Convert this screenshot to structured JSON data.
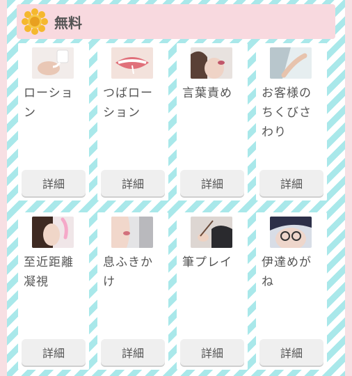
{
  "header": {
    "title": "無料",
    "icon": "flower-icon"
  },
  "colors": {
    "stripe": "#a9e8ea",
    "header_bg": "#f8d9df",
    "page_bg": "#f7dfe3"
  },
  "items": [
    {
      "label": "ローション",
      "button": "詳細",
      "thumb": "lotion-photo"
    },
    {
      "label": "つばローション",
      "button": "詳細",
      "thumb": "lips-photo"
    },
    {
      "label": "言葉責め",
      "button": "詳細",
      "thumb": "whisper-photo"
    },
    {
      "label": "お客様のちくびさわり",
      "button": "詳細",
      "thumb": "hand-touch-photo"
    },
    {
      "label": "至近距離凝視",
      "button": "詳細",
      "thumb": "closeup-gaze-photo"
    },
    {
      "label": "息ふきかけ",
      "button": "詳細",
      "thumb": "breath-photo"
    },
    {
      "label": "筆プレイ",
      "button": "詳細",
      "thumb": "brush-photo"
    },
    {
      "label": "伊達めがね",
      "button": "詳細",
      "thumb": "glasses-photo"
    }
  ]
}
